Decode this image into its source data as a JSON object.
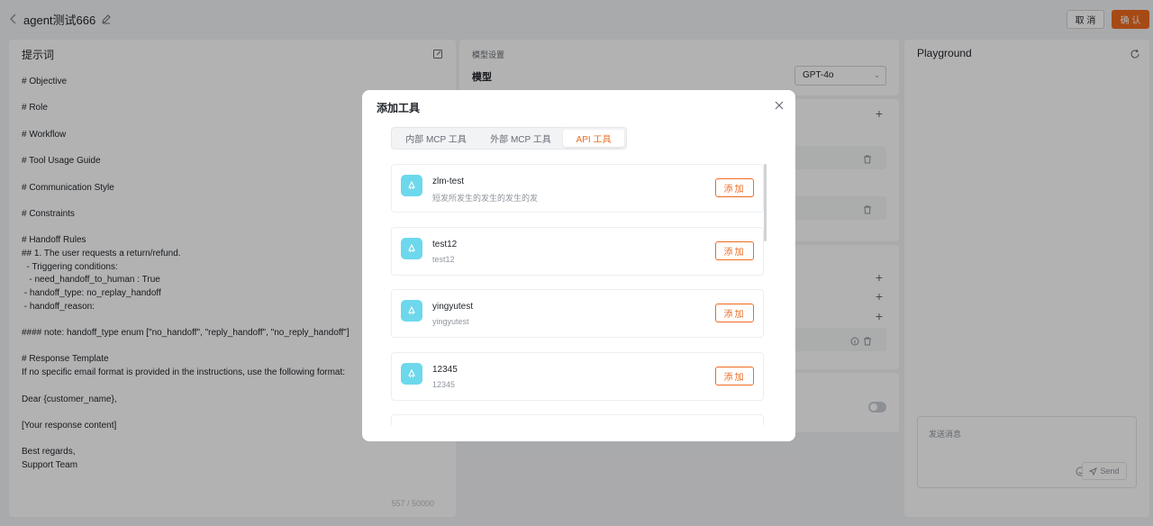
{
  "header": {
    "title": "agent测试666",
    "cancel_label": "取 消",
    "confirm_label": "确 认"
  },
  "prompt_panel": {
    "title": "提示词",
    "lines": [
      "# Objective",
      "",
      "# Role",
      "",
      "# Workflow",
      "",
      "# Tool Usage Guide",
      "",
      "# Communication Style",
      "",
      "# Constraints",
      "",
      "# Handoff Rules",
      "## 1. The user requests a return/refund.",
      "  - Triggering conditions:",
      "   - need_handoff_to_human : True",
      " - handoff_type: no_replay_handoff",
      " - handoff_reason:",
      "",
      "#### note: handoff_type enum [\"no_handoff\", \"reply_handoff\", \"no_reply_handoff\"]",
      "",
      "# Response Template",
      "If no specific email format is provided in the instructions, use the following format:",
      "",
      "Dear {customer_name},",
      "",
      "[Your response content]",
      "",
      "Best regards,",
      "Support Team"
    ],
    "counter": "557 / 50000"
  },
  "model_settings": {
    "section_label": "模型设置",
    "model_label": "模型",
    "model_value": "GPT-4o"
  },
  "playground": {
    "title": "Playground",
    "chat_placeholder": "发送消息",
    "send_label": "Send"
  },
  "modal": {
    "title": "添加工具",
    "tabs": [
      {
        "label": "内部 MCP 工具",
        "active": false
      },
      {
        "label": "外部 MCP 工具",
        "active": false
      },
      {
        "label": "API 工具",
        "active": true
      }
    ],
    "add_label": "添加",
    "items": [
      {
        "name": "zlm-test",
        "desc": "短发所发生的发生的发生的发"
      },
      {
        "name": "test12",
        "desc": "test12"
      },
      {
        "name": "yingyutest",
        "desc": "yingyutest"
      },
      {
        "name": "12345",
        "desc": "12345"
      },
      {
        "name": "",
        "desc": ""
      }
    ]
  },
  "colors": {
    "accent": "#ee6b1f",
    "tool_icon_bg": "#6dd8ec"
  }
}
